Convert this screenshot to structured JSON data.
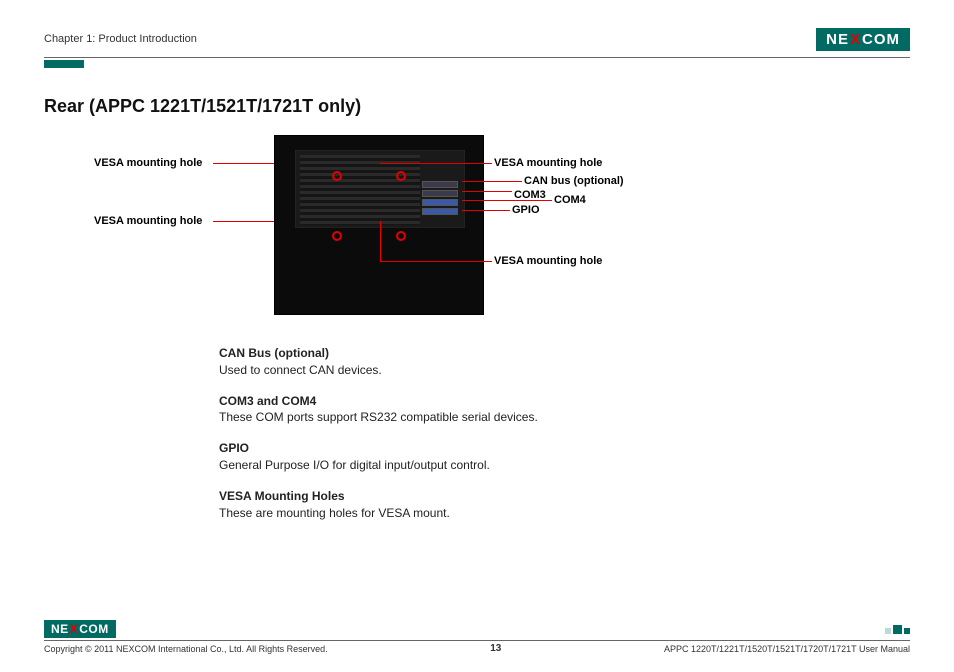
{
  "header": {
    "chapter": "Chapter 1: Product Introduction"
  },
  "brand": {
    "pre": "NE",
    "x": "X",
    "post": "COM"
  },
  "heading": "Rear (APPC 1221T/1521T/1721T only)",
  "labels": {
    "vesa_left_top": "VESA mounting hole",
    "vesa_left_bottom": "VESA mounting hole",
    "vesa_right_top": "VESA mounting hole",
    "can_bus": "CAN bus (optional)",
    "com3": "COM3",
    "com4": "COM4",
    "gpio": "GPIO",
    "vesa_right_bottom": "VESA mounting hole"
  },
  "descriptions": [
    {
      "term": "CAN Bus (optional)",
      "body": "Used to connect CAN devices."
    },
    {
      "term": "COM3 and COM4",
      "body": "These COM ports support RS232 compatible serial devices."
    },
    {
      "term": "GPIO",
      "body": "General Purpose I/O for digital input/output control."
    },
    {
      "term": "VESA Mounting Holes",
      "body": "These are mounting holes for VESA mount."
    }
  ],
  "footer": {
    "copyright": "Copyright © 2011 NEXCOM International Co., Ltd. All Rights Reserved.",
    "page": "13",
    "manual": "APPC 1220T/1221T/1520T/1521T/1720T/1721T User Manual"
  }
}
